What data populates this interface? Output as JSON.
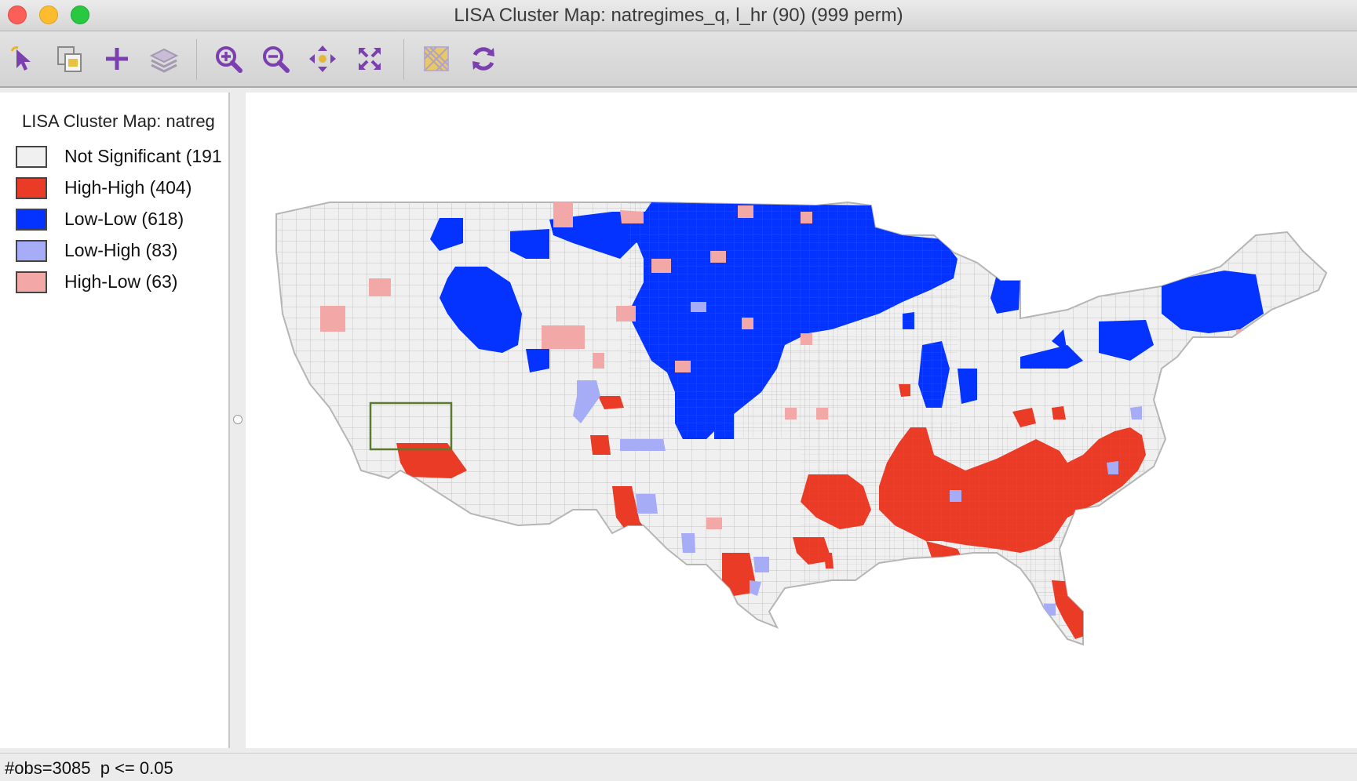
{
  "window": {
    "title": "LISA Cluster Map: natregimes_q, l_hr (90) (999 perm)"
  },
  "toolbar": {
    "buttons": [
      {
        "name": "select-tool",
        "icon": "pointer-arrow-icon"
      },
      {
        "name": "copy-image",
        "icon": "copy-image-icon"
      },
      {
        "name": "add-layer",
        "icon": "plus-icon"
      },
      {
        "name": "layers",
        "icon": "layers-icon"
      },
      {
        "name": "zoom-in",
        "icon": "zoom-in-icon"
      },
      {
        "name": "zoom-out",
        "icon": "zoom-out-icon"
      },
      {
        "name": "pan",
        "icon": "pan-arrows-icon"
      },
      {
        "name": "full-extent",
        "icon": "full-extent-icon"
      },
      {
        "name": "basemap",
        "icon": "basemap-icon"
      },
      {
        "name": "refresh",
        "icon": "refresh-icon"
      }
    ]
  },
  "legend": {
    "title": "LISA Cluster Map: natreg",
    "items": [
      {
        "label": "Not Significant (191",
        "color": "#f0f0f0"
      },
      {
        "label": "High-High (404)",
        "color": "#ea3b27"
      },
      {
        "label": "Low-Low (618)",
        "color": "#0433ff"
      },
      {
        "label": "Low-High (83)",
        "color": "#a7acf7"
      },
      {
        "label": "High-Low (63)",
        "color": "#f3a8a8"
      }
    ]
  },
  "map": {
    "colors": {
      "not_significant": "#f0f0f0",
      "high_high": "#ea3b27",
      "low_low": "#0433ff",
      "low_high": "#a7acf7",
      "high_low": "#f3a8a8",
      "border": "#c4c4c4",
      "selection_box": "#5a7a2e"
    }
  },
  "status": {
    "text": "#obs=3085  p <= 0.05"
  }
}
